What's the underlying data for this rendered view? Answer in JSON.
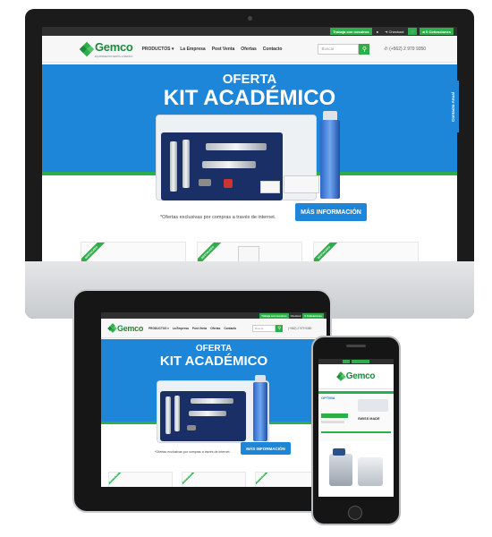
{
  "site": {
    "topbar": {
      "work": "Trabaja con nosotros",
      "checkout": "Checkout",
      "quotes": "0 Cotizaciones"
    },
    "logo": {
      "name": "Gemco",
      "tagline": "EQUIPAMIENTO DENTAL & MEDICO"
    },
    "nav": [
      "PRODUCTOS ▾",
      "La Empresa",
      "Post Venta",
      "Ofertas",
      "Contacto"
    ],
    "search_placeholder": "Buscar",
    "phone": "(+562) 2 979 9350",
    "hero": {
      "title1": "OFERTA",
      "title2": "KIT ACADÉMICO",
      "caption": "*Ofertas exclusivas por compras a través de internet.",
      "cta": "MÁS INFORMACIÓN"
    },
    "ribbon": "DESTACADO",
    "side_tab": "Contacto Anual",
    "mobile": {
      "banner": "OPTIMA",
      "badge": "SWISS MADE"
    }
  },
  "colors": {
    "brand_green": "#2eae4a",
    "hero_blue": "#1e86d8",
    "dark_bar": "#2f2f2f"
  },
  "icons": [
    "user-icon",
    "checkout-icon",
    "cart-icon",
    "quote-icon",
    "search-icon",
    "phone-icon",
    "camera-icon",
    "home-button-icon"
  ]
}
